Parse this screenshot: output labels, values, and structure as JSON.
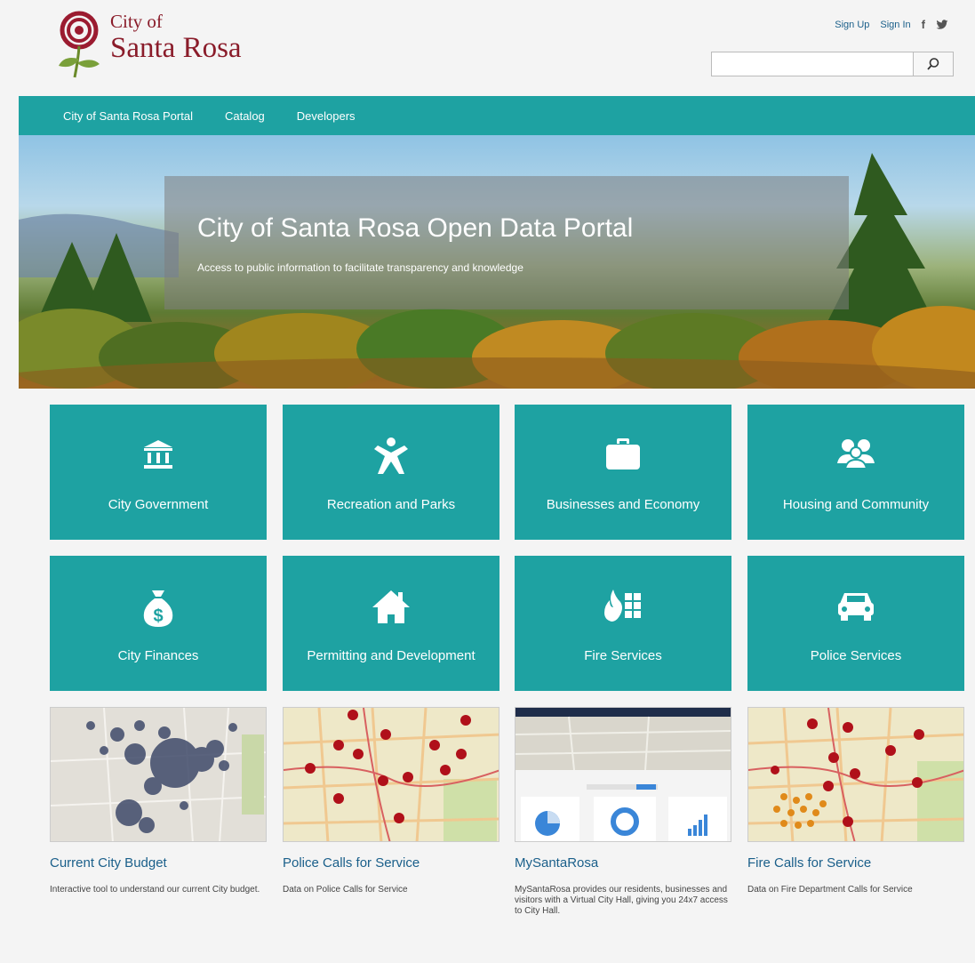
{
  "header": {
    "logo_small": "City of",
    "logo_big": "Santa Rosa",
    "sign_up": "Sign Up",
    "sign_in": "Sign In",
    "facebook": "f",
    "search_placeholder": ""
  },
  "nav": {
    "items": [
      "City of Santa Rosa Portal",
      "Catalog",
      "Developers"
    ]
  },
  "hero": {
    "title": "City of Santa Rosa Open Data Portal",
    "subtitle": "Access to public information to facilitate transparency and knowledge"
  },
  "tiles": [
    {
      "label": "City Government",
      "icon": "government-building-icon"
    },
    {
      "label": "Recreation and Parks",
      "icon": "person-star-icon"
    },
    {
      "label": "Businesses and Economy",
      "icon": "briefcase-icon"
    },
    {
      "label": "Housing and Community",
      "icon": "people-group-icon"
    },
    {
      "label": "City Finances",
      "icon": "money-bag-icon"
    },
    {
      "label": "Permitting and Development",
      "icon": "house-icon"
    },
    {
      "label": "Fire Services",
      "icon": "fire-icon"
    },
    {
      "label": "Police Services",
      "icon": "car-icon"
    }
  ],
  "cards": [
    {
      "title": "Current City Budget",
      "desc": "Interactive tool to understand our current City budget."
    },
    {
      "title": "Police Calls for Service",
      "desc": "Data on Police Calls for Service"
    },
    {
      "title": "MySantaRosa",
      "desc": "MySantaRosa provides our residents, businesses and visitors with a Virtual City Hall, giving you 24x7 access to City Hall."
    },
    {
      "title": "Fire Calls for Service",
      "desc": "Data on Fire Department Calls for Service"
    }
  ],
  "colors": {
    "teal": "#1ea2a2",
    "link": "#1a5f8a",
    "brand": "#8a1c2a"
  }
}
